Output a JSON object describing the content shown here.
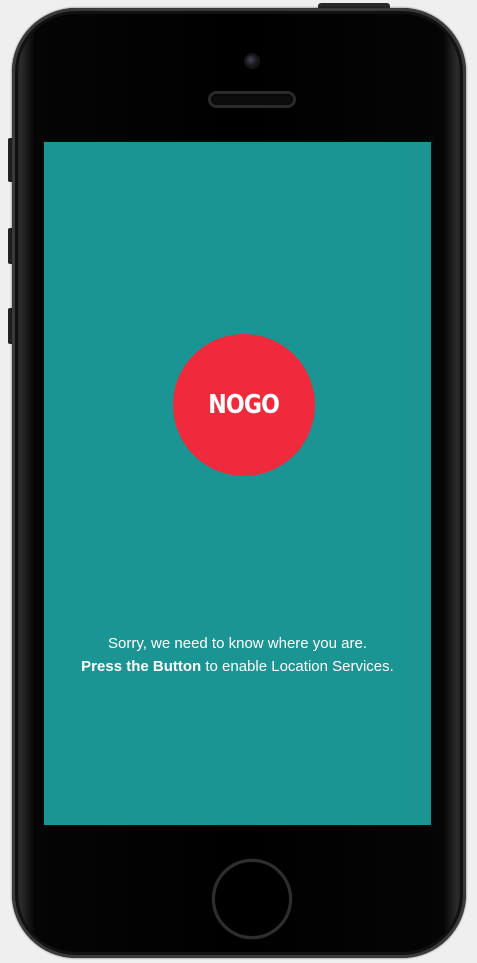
{
  "app": {
    "button_label": "NOGO",
    "message_line1": "Sorry, we need to know where you are.",
    "message_bold": "Press the Button",
    "message_rest": " to enable Location Services."
  },
  "colors": {
    "screen_background": "#1b9494",
    "button_background": "#ef2a3c",
    "text": "#ffffff"
  }
}
